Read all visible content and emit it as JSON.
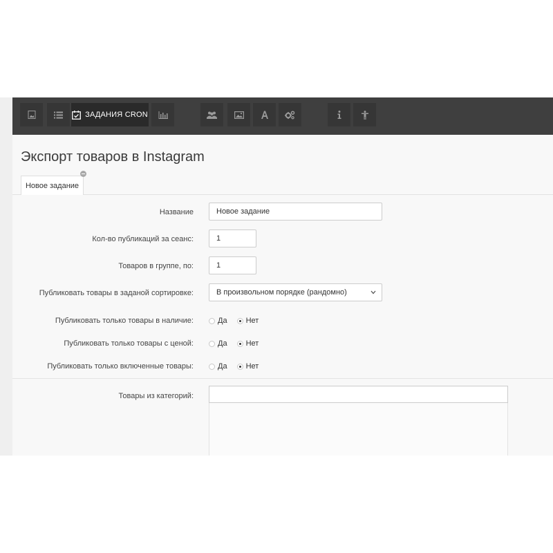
{
  "toolbar": {
    "active_label": "ЗАДАНИЯ CRON",
    "icons": [
      "image-icon",
      "list-icon",
      "calendar-check-icon",
      "bar-chart-icon",
      "users-icon",
      "picture-icon",
      "font-icon",
      "gears-icon",
      "info-icon",
      "person-icon"
    ]
  },
  "page": {
    "title": "Экспорт товаров в Instagram"
  },
  "tabs": [
    {
      "label": "Новое задание"
    }
  ],
  "form": {
    "name_label": "Название",
    "name_value": "Новое задание",
    "per_session_label": "Кол-во публикаций за сеанс:",
    "per_session_value": "1",
    "group_label": "Товаров в группе, по:",
    "group_value": "1",
    "sort_label": "Публиковать товары в заданой сортировке:",
    "sort_value": "В произвольном порядке (рандомно)",
    "in_stock_label": "Публиковать только товары в наличие:",
    "with_price_label": "Публиковать только товары с ценой:",
    "enabled_label": "Публиковать только включенные товары:",
    "yes": "Да",
    "no": "Нет",
    "categories_label": "Товары из категорий:"
  },
  "colors": {
    "toolbar_bg": "#3f3f3f",
    "button_bg": "#363636",
    "active_button_bg": "#2a2a2a",
    "page_bg": "#f8f8f8"
  }
}
